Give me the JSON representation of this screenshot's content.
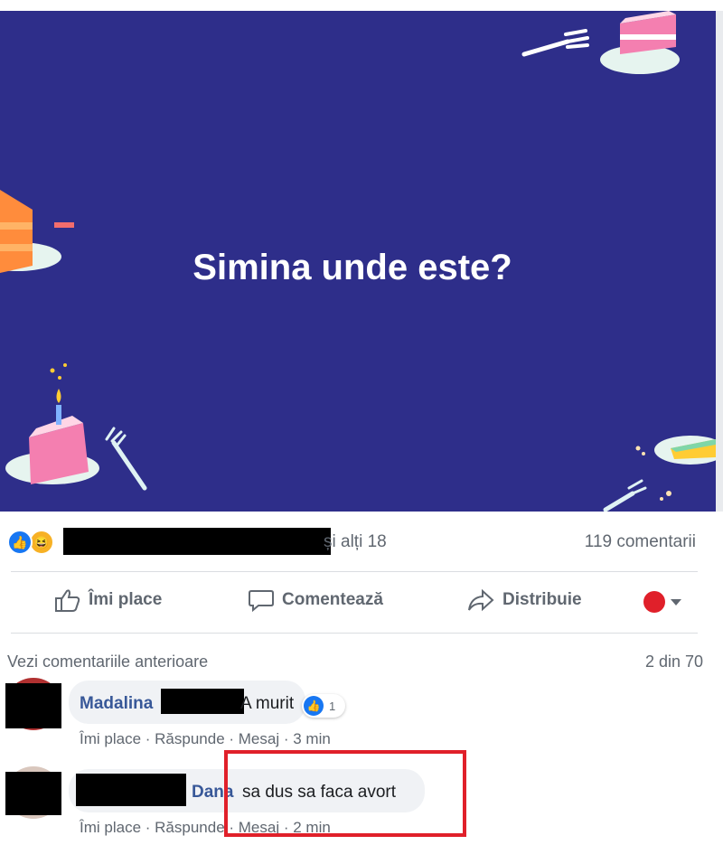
{
  "post": {
    "text": "Simina unde este?",
    "background_color": "#2e2e8a"
  },
  "reactions": {
    "icons": [
      "like-icon",
      "haha-icon"
    ],
    "others_text": "și alți 18",
    "comment_count_text": "119 comentarii"
  },
  "actions": {
    "like_label": "Îmi place",
    "comment_label": "Comentează",
    "share_label": "Distribuie"
  },
  "comments_section": {
    "view_previous": "Vezi comentariile anterioare",
    "count": "2 din 70"
  },
  "comments": [
    {
      "name": "Madalina",
      "text": "A murit",
      "like_count": "1",
      "meta": {
        "like": "Îmi place",
        "reply": "Răspunde",
        "message": "Mesaj",
        "time": "3 min"
      }
    },
    {
      "name": "Dana",
      "text": "sa dus sa faca avort",
      "meta": {
        "like": "Îmi place",
        "reply": "Răspunde",
        "message": "Mesaj",
        "time": "2 min"
      }
    }
  ],
  "colors": {
    "link_blue": "#385898",
    "highlight_red": "#e0202a",
    "meta_gray": "#606770"
  }
}
